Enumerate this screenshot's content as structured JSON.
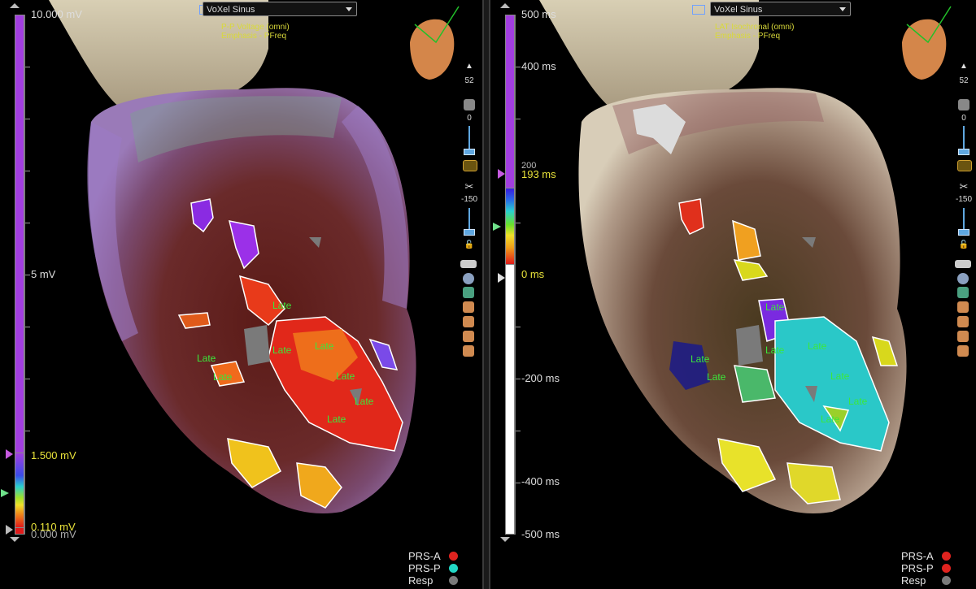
{
  "left": {
    "map_select": "VoXel Sinus",
    "subtitle_line1": "P-P Voltage (omni)",
    "subtitle_line2": "Emphasis - PFreq",
    "scale": {
      "top_label": "10.000 mV",
      "mid_label": "5 mV",
      "upper_threshold": "1.500 mV",
      "lower_threshold": "0.110 mV",
      "bottom_label": "0.000 mV"
    },
    "late_labels": [
      "Late",
      "Late",
      "Late",
      "Late",
      "Late",
      "Late",
      "Late",
      "Late"
    ],
    "toolbar": {
      "view_value": "52",
      "opacity_value": "0",
      "clip_value": "-150"
    },
    "legend": [
      {
        "label": "PRS-A",
        "color": "#e0231f"
      },
      {
        "label": "PRS-P",
        "color": "#22d6c4"
      },
      {
        "label": "Resp",
        "color": "#7a7a7a"
      }
    ]
  },
  "right": {
    "map_select": "VoXel Sinus",
    "subtitle_line1": "LAT Isochronal (omni)",
    "subtitle_line2": "Emphasis - PFreq",
    "scale": {
      "top_label": "500 ms",
      "label_400": "400 ms",
      "overlap_label": "200",
      "upper_threshold": "193 ms",
      "zero_label": "0 ms",
      "label_neg200": "-200 ms",
      "label_neg400": "-400 ms",
      "bottom_label": "-500 ms"
    },
    "late_labels": [
      "Late",
      "Late",
      "Late",
      "Late",
      "Late",
      "Late",
      "Late",
      "Late"
    ],
    "toolbar": {
      "view_value": "52",
      "opacity_value": "0",
      "clip_value": "-150"
    },
    "legend": [
      {
        "label": "PRS-A",
        "color": "#e0231f"
      },
      {
        "label": "PRS-P",
        "color": "#e0231f"
      },
      {
        "label": "Resp",
        "color": "#7a7a7a"
      }
    ]
  }
}
